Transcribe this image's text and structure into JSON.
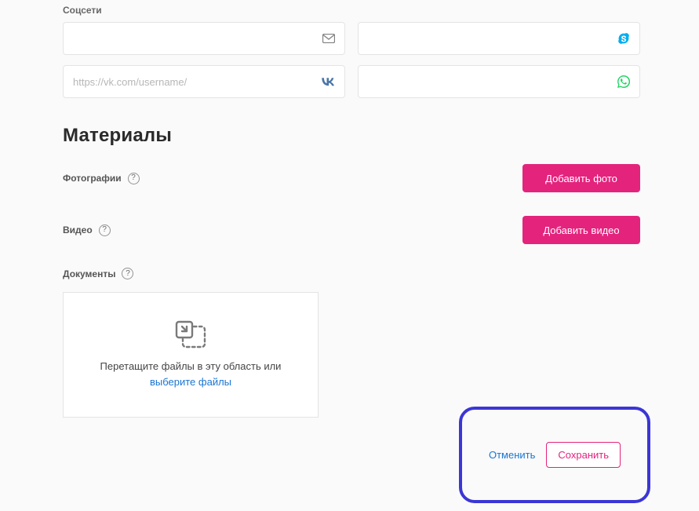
{
  "social": {
    "label": "Соцсети",
    "email": {
      "value": "",
      "placeholder": ""
    },
    "skype": {
      "value": "",
      "placeholder": ""
    },
    "vk": {
      "value": "",
      "placeholder": "https://vk.com/username/"
    },
    "whatsapp": {
      "value": "",
      "placeholder": ""
    }
  },
  "materials": {
    "heading": "Материалы",
    "photos": {
      "label": "Фотографии",
      "button": "Добавить фото"
    },
    "videos": {
      "label": "Видео",
      "button": "Добавить видео"
    },
    "docs": {
      "label": "Документы"
    },
    "dropzone": {
      "line1": "Перетащите файлы в эту область или",
      "link": "выберите файлы"
    }
  },
  "actions": {
    "cancel": "Отменить",
    "save": "Сохранить"
  }
}
